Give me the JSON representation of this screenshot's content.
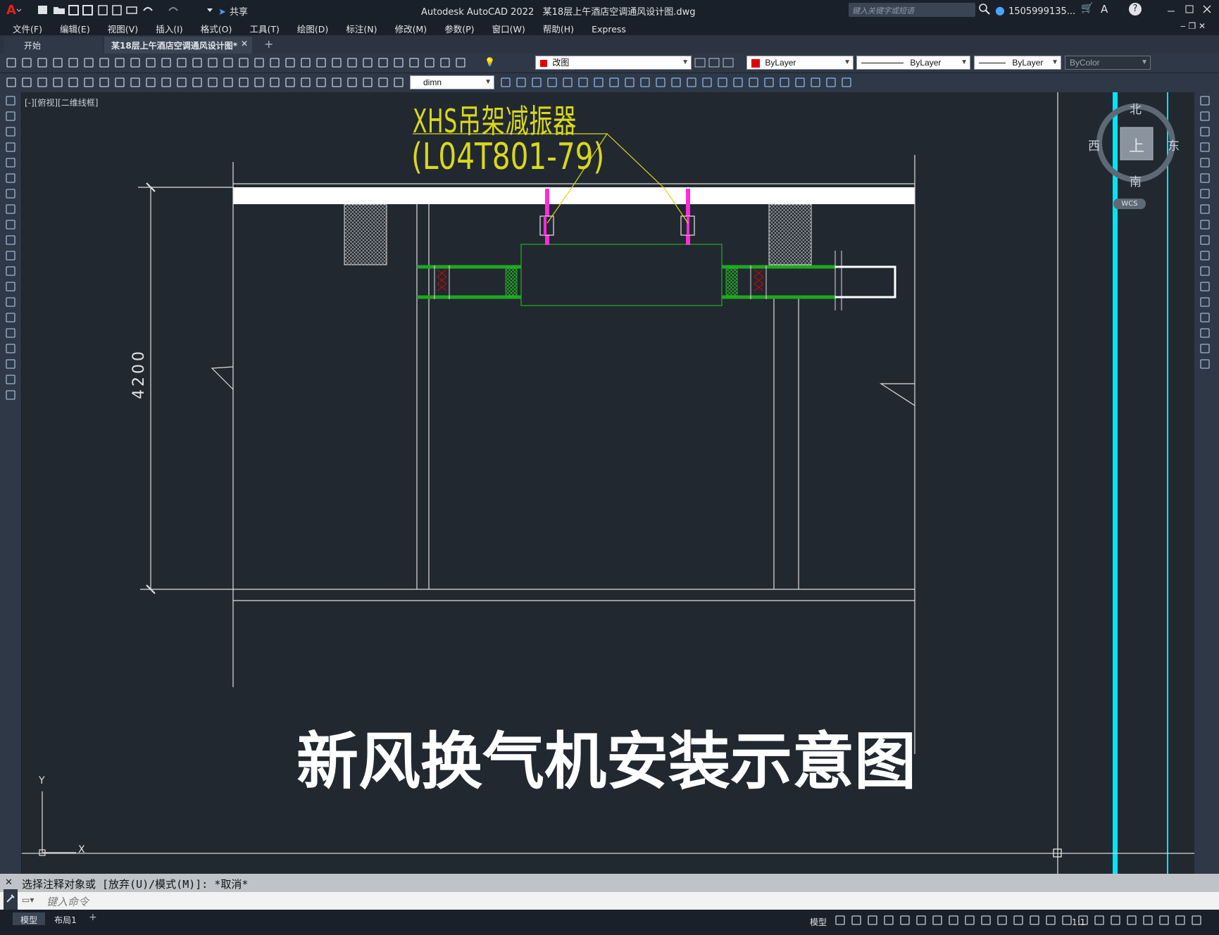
{
  "app": {
    "title": "Autodesk AutoCAD 2022",
    "filename": "某18层上午酒店空调通风设计图.dwg",
    "share_label": "共享",
    "search_placeholder": "键入关键字或短语",
    "user": "1505999135...",
    "help": "?"
  },
  "menu": [
    "文件(F)",
    "编辑(E)",
    "视图(V)",
    "插入(I)",
    "格式(O)",
    "工具(T)",
    "绘图(D)",
    "标注(N)",
    "修改(M)",
    "参数(P)",
    "窗口(W)",
    "帮助(H)",
    "Express"
  ],
  "tabs": [
    {
      "label": "开始",
      "active": false
    },
    {
      "label": "某18层上午酒店空调通风设计图*",
      "active": true
    }
  ],
  "toolbar": {
    "layer": "改图",
    "color": "ByLayer",
    "linetype": "ByLayer",
    "lineweight": "ByLayer",
    "plotstyle": "ByColor",
    "dimstyle": "dimn"
  },
  "viewport_label": "[-][俯视][二维线框]",
  "viewcube": {
    "north": "北",
    "south": "南",
    "east": "东",
    "west": "西",
    "face": "上",
    "wcs": "WCS"
  },
  "drawing": {
    "label_line1": "XHS吊架减振器",
    "label_line2": "(L04T801-79)",
    "dimension": "4200",
    "title": "新风换气机安装示意图",
    "ucs_x": "X",
    "ucs_y": "Y"
  },
  "command": {
    "history": "选择注释对象或 [放弃(U)/模式(M)]: *取消*",
    "placeholder": "键入命令"
  },
  "layout_tabs": [
    "模型",
    "布局1"
  ],
  "status": {
    "model": "模型",
    "scale": "1:1"
  },
  "colors": {
    "accent_cyan": "#00e5f5",
    "magenta": "#ff2bd6",
    "green": "#1fa81f",
    "yellow": "#d8d81a"
  }
}
